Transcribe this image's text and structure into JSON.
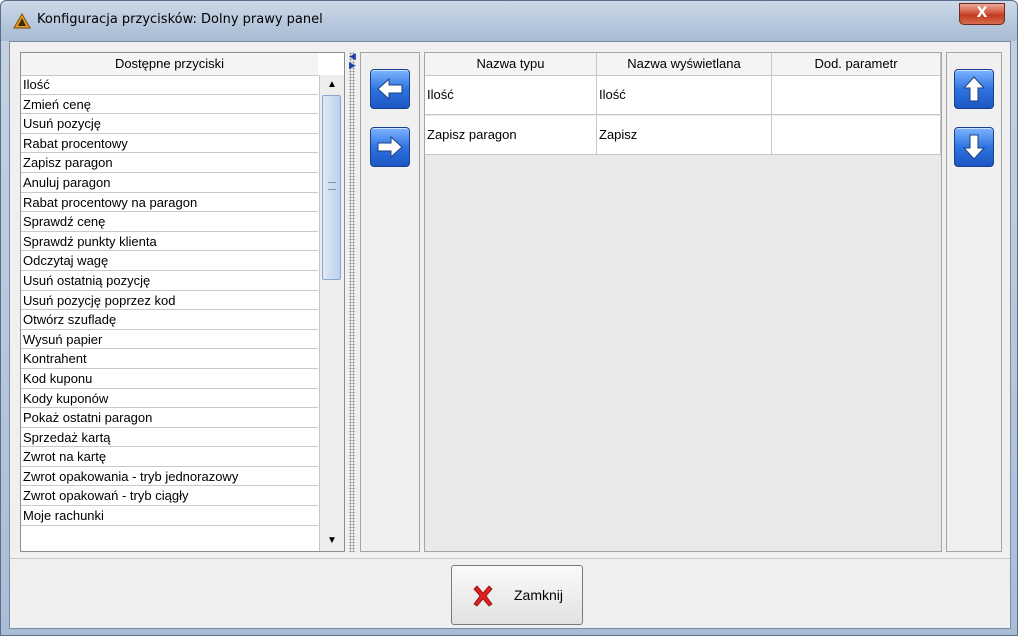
{
  "window": {
    "title": "Konfiguracja przycisków: Dolny prawy panel",
    "close_glyph": "X"
  },
  "available_list": {
    "header": "Dostępne przyciski",
    "items": [
      "Ilość",
      "Zmień cenę",
      "Usuń pozycję",
      "Rabat procentowy",
      "Zapisz paragon",
      "Anuluj paragon",
      "Rabat procentowy na paragon",
      "Sprawdź cenę",
      "Sprawdź punkty klienta",
      "Odczytaj wagę",
      "Usuń ostatnią pozycję",
      "Usuń pozycję poprzez kod",
      "Otwórz szufladę",
      "Wysuń papier",
      "Kontrahent",
      "Kod kuponu",
      "Kody kuponów",
      "Pokaż ostatni paragon",
      "Sprzedaż kartą",
      "Zwrot na kartę",
      "Zwrot opakowania - tryb jednorazowy",
      "Zwrot opakowań - tryb ciągły",
      "Moje rachunki"
    ]
  },
  "assigned_table": {
    "columns": [
      "Nazwa typu",
      "Nazwa wyświetlana",
      "Dod. parametr"
    ],
    "rows": [
      [
        "Ilość",
        "Ilość",
        ""
      ],
      [
        "Zapisz paragon",
        "Zapisz",
        ""
      ]
    ]
  },
  "icons": {
    "title": "app-logo-icon",
    "move_left": "arrow-left-icon",
    "move_right": "arrow-right-icon",
    "move_up": "arrow-up-icon",
    "move_down": "arrow-down-icon",
    "close": "red-x-icon"
  },
  "footer": {
    "close_label": "Zamknij"
  },
  "colors": {
    "accent_blue": "#2f74e0",
    "close_red": "#e02020",
    "titlebar_close": "#c23a20"
  }
}
